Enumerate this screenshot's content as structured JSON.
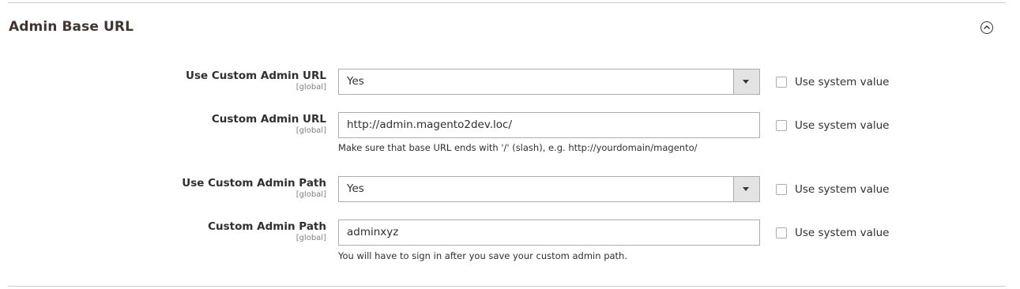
{
  "section": {
    "title": "Admin Base URL"
  },
  "fields": [
    {
      "label": "Use Custom Admin URL",
      "scope": "[global]",
      "type": "select",
      "value": "Yes",
      "system_value_label": "Use system value",
      "system_value_checked": false
    },
    {
      "label": "Custom Admin URL",
      "scope": "[global]",
      "type": "text",
      "value": "http://admin.magento2dev.loc/",
      "note": "Make sure that base URL ends with '/' (slash), e.g. http://yourdomain/magento/",
      "system_value_label": "Use system value",
      "system_value_checked": false
    },
    {
      "label": "Use Custom Admin Path",
      "scope": "[global]",
      "type": "select",
      "value": "Yes",
      "system_value_label": "Use system value",
      "system_value_checked": false
    },
    {
      "label": "Custom Admin Path",
      "scope": "[global]",
      "type": "text",
      "value": "adminxyz",
      "note": "You will have to sign in after you save your custom admin path.",
      "system_value_label": "Use system value",
      "system_value_checked": false
    }
  ],
  "icons": {
    "collapse": "chevron-up-circle-icon",
    "select_arrow": "caret-down-icon"
  }
}
